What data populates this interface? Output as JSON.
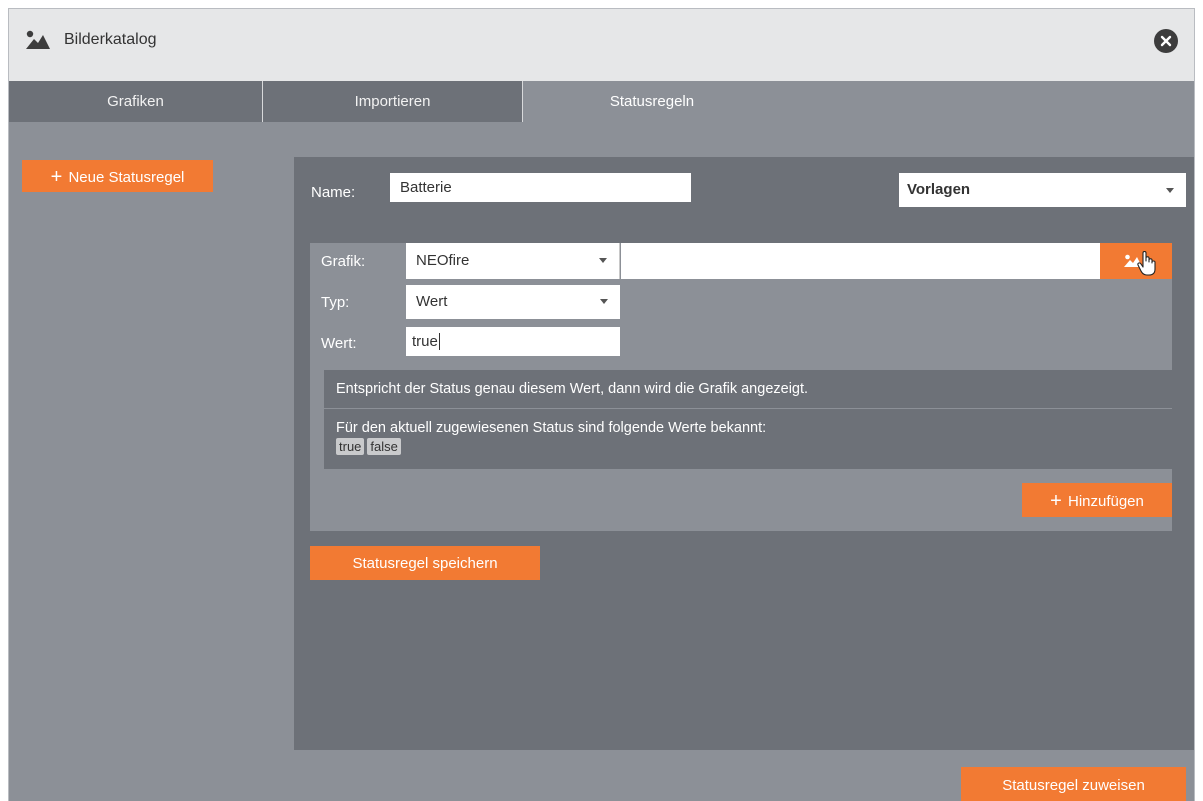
{
  "window": {
    "title": "Bilderkatalog"
  },
  "tabs": [
    {
      "label": "Grafiken"
    },
    {
      "label": "Importieren"
    },
    {
      "label": "Statusregeln"
    }
  ],
  "sidebar": {
    "new_rule_label": "Neue Statusregel"
  },
  "form": {
    "name_label": "Name:",
    "name_value": "Batterie",
    "templates_label": "Vorlagen",
    "grafik_label": "Grafik:",
    "grafik_value": "NEOfire",
    "typ_label": "Typ:",
    "typ_value": "Wert",
    "wert_label": "Wert:",
    "wert_value": "true",
    "hint": "Entspricht der Status genau diesem Wert, dann wird die Grafik angezeigt.",
    "known_values_text": "Für den aktuell zugewiesenen Status sind folgende Werte bekannt:",
    "known_values": [
      "true",
      "false"
    ],
    "add_label": "Hinzufügen",
    "save_label": "Statusregel speichern"
  },
  "footer": {
    "assign_label": "Statusregel zuweisen"
  },
  "colors": {
    "accent": "#f27a33",
    "panel_dark": "#6d7178",
    "panel_mid": "#8c9097",
    "titlebar": "#e6e7e8"
  },
  "icons": {
    "title": "image-icon",
    "close": "close-icon",
    "picker": "image-icon",
    "cursor": "hand-cursor-icon"
  }
}
